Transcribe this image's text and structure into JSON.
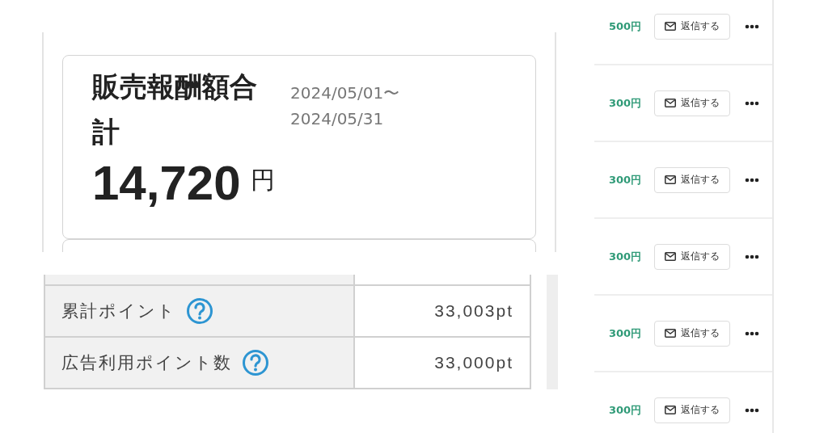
{
  "summary_card": {
    "title": "販売報酬額合計",
    "period_start": "2024/05/01〜",
    "period_end": "2024/05/31",
    "amount": "14,720",
    "unit": "円"
  },
  "points_table": {
    "rows": [
      {
        "label": "累計ポイント",
        "value": "33,003pt"
      },
      {
        "label": "広告利用ポイント数",
        "value": "33,000pt"
      }
    ]
  },
  "orders": [
    {
      "amount": "500円",
      "reply_label": "返信する"
    },
    {
      "amount": "300円",
      "reply_label": "返信する"
    },
    {
      "amount": "300円",
      "reply_label": "返信する"
    },
    {
      "amount": "300円",
      "reply_label": "返信する"
    },
    {
      "amount": "300円",
      "reply_label": "返信する"
    },
    {
      "amount": "300円",
      "reply_label": "返信する"
    }
  ]
}
